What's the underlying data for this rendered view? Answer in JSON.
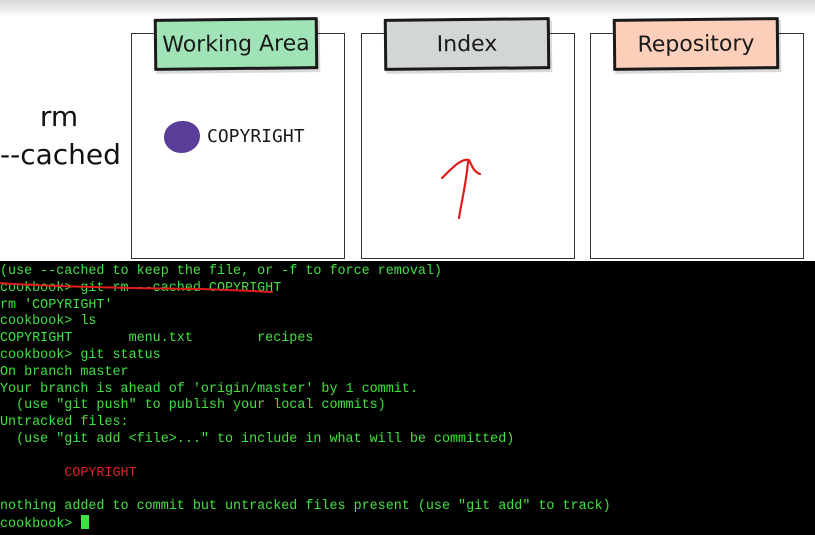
{
  "command_label": {
    "line1": "rm",
    "line2": "--cached"
  },
  "panels": [
    {
      "title": "Working Area",
      "title_color": "#9fe3b6"
    },
    {
      "title": "Index",
      "title_color": "#d3d6d6"
    },
    {
      "title": "Repository",
      "title_color": "#fbcfba"
    }
  ],
  "working_area_file": {
    "name": "COPYRIGHT",
    "dot_color": "#5a3d99"
  },
  "annotation": {
    "arrow_color": "#e01b1b"
  },
  "terminal": {
    "lines": [
      {
        "text": "(use --cached to keep the file, or -f to force removal)",
        "color": "green"
      },
      {
        "text": "cookbook> git rm --cached COPYRIGHT",
        "color": "green"
      },
      {
        "text": "rm 'COPYRIGHT'",
        "color": "green"
      },
      {
        "text": "cookbook> ls",
        "color": "green"
      },
      {
        "text": "COPYRIGHT       menu.txt        recipes",
        "color": "green"
      },
      {
        "text": "cookbook> git status",
        "color": "green"
      },
      {
        "text": "On branch master",
        "color": "green"
      },
      {
        "text": "Your branch is ahead of 'origin/master' by 1 commit.",
        "color": "green"
      },
      {
        "text": "  (use \"git push\" to publish your local commits)",
        "color": "green"
      },
      {
        "text": "Untracked files:",
        "color": "green"
      },
      {
        "text": "  (use \"git add <file>...\" to include in what will be committed)",
        "color": "green"
      },
      {
        "text": "",
        "color": "green"
      },
      {
        "text": "        COPYRIGHT",
        "color": "red"
      },
      {
        "text": "",
        "color": "green"
      },
      {
        "text": "nothing added to commit but untracked files present (use \"git add\" to track)",
        "color": "green"
      },
      {
        "text": "cookbook> ",
        "color": "green"
      }
    ]
  }
}
